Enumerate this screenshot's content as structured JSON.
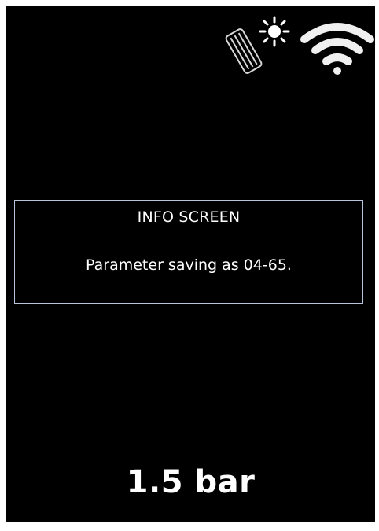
{
  "status": {
    "icons": [
      "heater-icon",
      "sun-icon",
      "wifi-icon"
    ]
  },
  "dialog": {
    "title": "INFO SCREEN",
    "message": "Parameter saving as 04-65."
  },
  "pressure": {
    "display": "1.5 bar"
  },
  "colors": {
    "background": "#000000",
    "text": "#ffffff",
    "border": "#b8c4dc"
  }
}
